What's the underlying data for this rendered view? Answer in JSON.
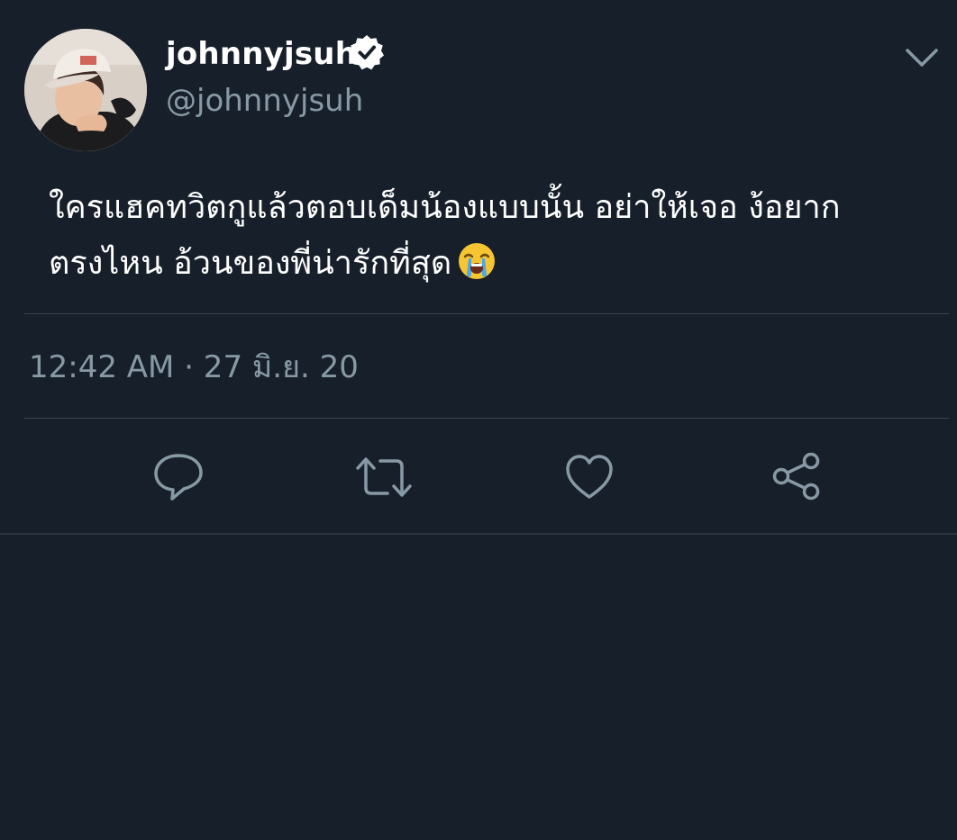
{
  "user": {
    "display_name": "johnnyjsuh",
    "handle": "@johnnyjsuh",
    "verified": true
  },
  "tweet": {
    "text_line1": "ใครแฮคทวิตกูแล้วตอบเด็มน้องแบบนั้น อย่าให้เจอ ง้อยาก",
    "text_line2": "ตรงไหน อ้วนของพี่น่ารักที่สุด",
    "emoji": "loudly-crying-face",
    "timestamp": "12:42 AM · 27 มิ.ย. 20"
  },
  "actions": [
    {
      "icon": "reply-icon"
    },
    {
      "icon": "retweet-icon"
    },
    {
      "icon": "like-icon"
    },
    {
      "icon": "share-icon"
    }
  ],
  "colors": {
    "background": "#17202a",
    "primary_text": "#ffffff",
    "secondary_text": "#8899a6",
    "divider": "#38444d",
    "verified_badge": "#ffffff"
  }
}
